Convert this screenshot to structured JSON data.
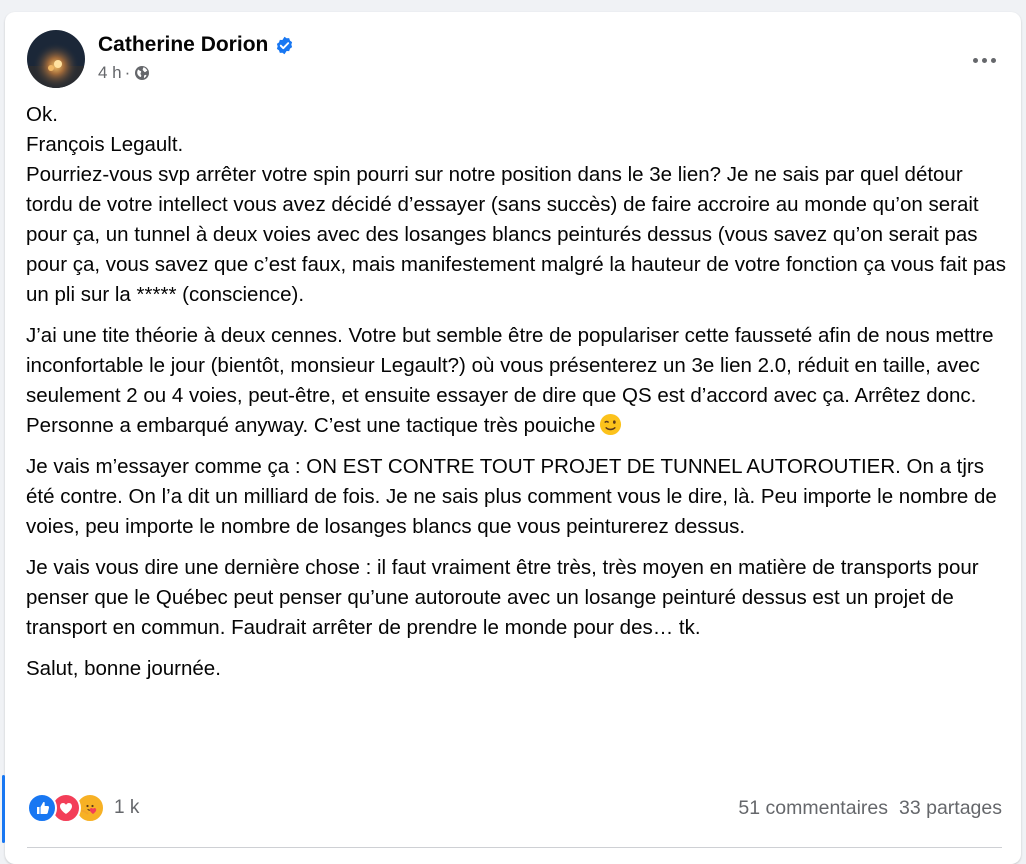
{
  "post": {
    "author": "Catherine Dorion",
    "timestamp": "4 h",
    "separator": "·",
    "privacy_icon": "globe-icon",
    "more_icon": "more-horizontal-icon",
    "paragraphs": [
      {
        "lines": [
          "Ok.",
          "François Legault.",
          "Pourriez-vous svp arrêter votre spin pourri sur notre position dans le 3e lien? Je ne sais par quel détour tordu de votre intellect vous avez décidé d’essayer (sans succès) de faire accroire au monde qu’on serait pour ça, un tunnel à deux voies avec des losanges blancs peinturés dessus (vous savez qu’on serait pas pour ça, vous savez que c’est faux, mais manifestement malgré la hauteur de votre fonction ça vous fait pas un pli sur la ***** (conscience)."
        ]
      },
      {
        "text": "J’ai une tite théorie à deux cennes. Votre but semble être de populariser cette fausseté afin de nous mettre inconfortable le jour (bientôt, monsieur Legault?) où vous présenterez un 3e lien 2.0, réduit en taille, avec seulement 2 ou 4 voies, peut-être, et ensuite essayer de dire que QS est d’accord avec ça. Arrêtez donc. Personne a embarqué anyway. C’est une tactique très pouiche",
        "emoji": "winking-face-icon"
      },
      {
        "text": "Je vais m’essayer comme ça : ON EST CONTRE TOUT PROJET DE TUNNEL AUTOROUTIER. On a tjrs été contre. On l’a dit un milliard de fois. Je ne sais plus comment vous le dire, là. Peu importe le nombre de voies, peu importe le nombre de losanges blancs que vous peinturerez dessus."
      },
      {
        "text": "Je vais vous dire une dernière chose : il faut vraiment être très, très moyen en matière de transports pour penser que le Québec peut penser qu’une autoroute avec un losange peinturé dessus est un projet de transport en commun. Faudrait arrêter de prendre le monde pour des… tk."
      },
      {
        "text": "Salut, bonne journée."
      }
    ]
  },
  "engagement": {
    "reaction_icons": [
      "like-icon",
      "love-icon",
      "care-icon"
    ],
    "reaction_count": "1 k",
    "comments": "51 commentaires",
    "shares": "33 partages"
  },
  "colors": {
    "accent": "#1877f2",
    "love": "#f33e58",
    "care": "#f7b125",
    "secondary_text": "#65676b"
  }
}
